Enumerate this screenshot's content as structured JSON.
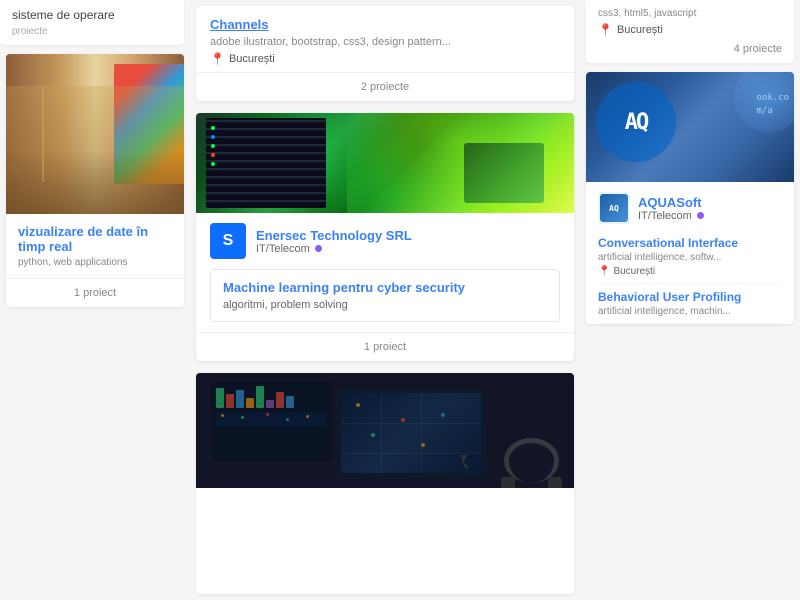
{
  "columns": {
    "left": {
      "top_card": {
        "title": "sisteme de operare",
        "projects_count": "proiecte"
      },
      "image_card": {
        "title": "vizualizare de date în timp real",
        "tags": "python, web applications",
        "projects_count": "1 proiect"
      }
    },
    "center": {
      "top_card": {
        "title": "Channels",
        "tags": "adobe ilustrator, bootstrap, css3, design pattern...",
        "location": "București",
        "projects_count": "2 proiecte"
      },
      "featured_card": {
        "company_name": "Enersec Technology SRL",
        "company_sector": "IT/Telecom",
        "company_logo_letter": "S",
        "project_title": "Machine learning pentru cyber security",
        "project_tags": "algoritmi, problem solving",
        "projects_count": "1 proiect"
      },
      "bottom_card": {
        "image_alt": "dashboard with map on tablet"
      }
    },
    "right": {
      "top_partial": {
        "tags": "css3, html5, javascript",
        "location": "București",
        "projects_count": "4 proiecte"
      },
      "aquasoft_card": {
        "company_name": "AQUASoft",
        "company_sector": "IT/Telecom",
        "projects": [
          {
            "title": "Conversational Interface",
            "tags": "artificial intelligence, softw..."
          },
          {
            "title": "Behavioral User Profiling",
            "tags": "artificial intelligence, machin..."
          }
        ],
        "location": "București"
      }
    }
  },
  "ui": {
    "location_pin": "📍",
    "dot_color": "#8b5cf6",
    "aquasoft_dot_color": "#8b5cf6"
  }
}
